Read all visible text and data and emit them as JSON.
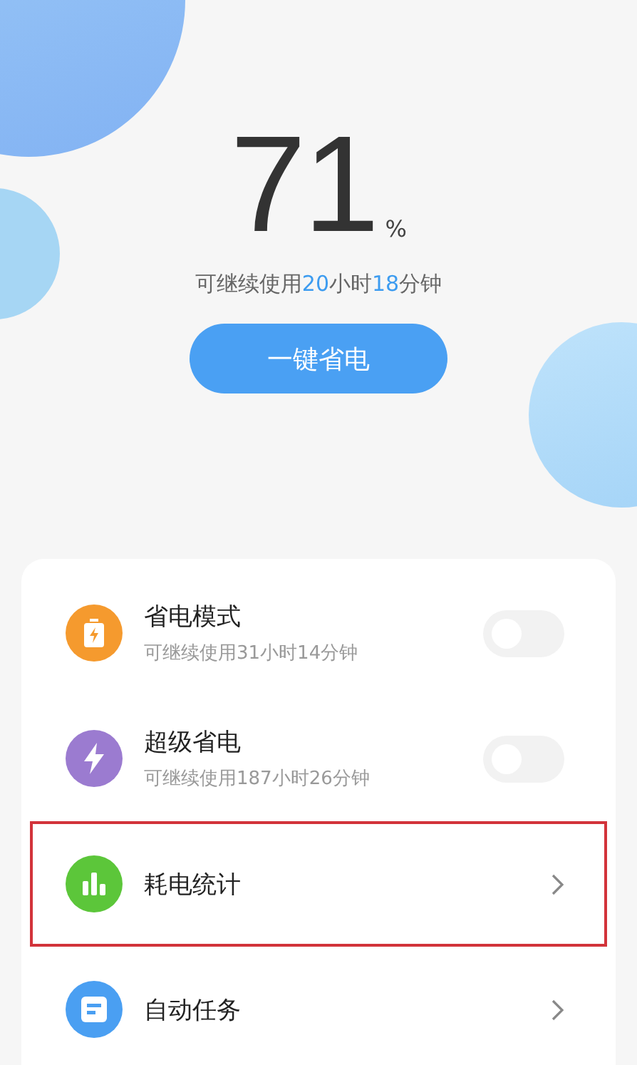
{
  "battery": {
    "percent": "71",
    "unit": "%",
    "remaining": [
      {
        "text": "可继续使用",
        "accent": false
      },
      {
        "text": "20",
        "accent": true
      },
      {
        "text": "小时",
        "accent": false
      },
      {
        "text": "18",
        "accent": true
      },
      {
        "text": "分钟",
        "accent": false
      }
    ]
  },
  "action_button": "一键省电",
  "items": [
    {
      "kind": "toggle",
      "color": "#f59a2e",
      "title": "省电模式",
      "subtitle": "可继续使用31小时14分钟",
      "on": false,
      "highlighted": false
    },
    {
      "kind": "toggle",
      "color": "#9b7bd0",
      "title": "超级省电",
      "subtitle": "可继续使用187小时26分钟",
      "on": false,
      "highlighted": false
    },
    {
      "kind": "link",
      "color": "#5cc63a",
      "title": "耗电统计",
      "highlighted": true
    },
    {
      "kind": "link",
      "color": "#4a9ff2",
      "title": "自动任务",
      "highlighted": false
    }
  ]
}
